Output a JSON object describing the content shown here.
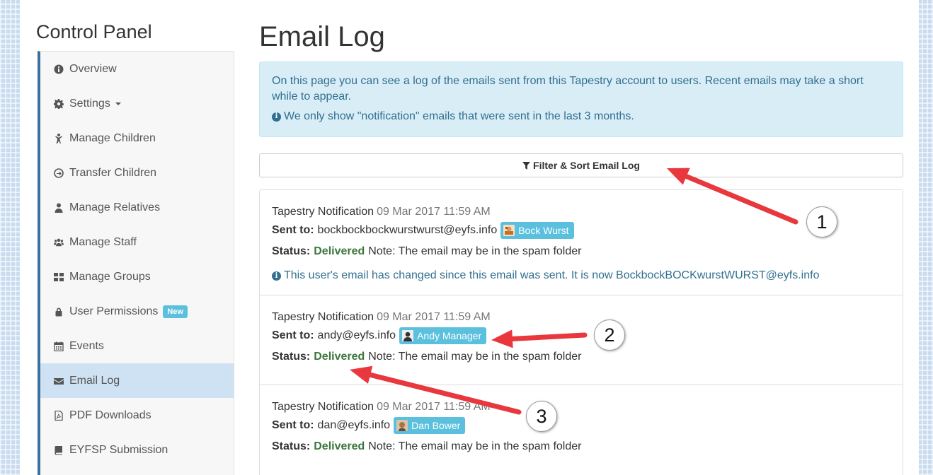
{
  "sidebar": {
    "title": "Control Panel",
    "items": [
      {
        "label": "Overview",
        "icon": "info-circle-icon"
      },
      {
        "label": "Settings",
        "icon": "gear-icon",
        "dropdown": true
      },
      {
        "label": "Manage Children",
        "icon": "child-icon"
      },
      {
        "label": "Transfer Children",
        "icon": "transfer-circle-icon"
      },
      {
        "label": "Manage Relatives",
        "icon": "user-icon"
      },
      {
        "label": "Manage Staff",
        "icon": "users-icon"
      },
      {
        "label": "Manage Groups",
        "icon": "grid-icon"
      },
      {
        "label": "User Permissions",
        "icon": "lock-icon",
        "badge": "New"
      },
      {
        "label": "Events",
        "icon": "calendar-icon"
      },
      {
        "label": "Email Log",
        "icon": "envelope-icon",
        "active": true
      },
      {
        "label": "PDF Downloads",
        "icon": "pdf-file-icon"
      },
      {
        "label": "EYFSP Submission",
        "icon": "book-icon"
      }
    ]
  },
  "main": {
    "title": "Email Log",
    "info": {
      "text": "On this page you can see a log of the emails sent from this Tapestry account to users. Recent emails may take a short while to appear.",
      "note": "We only show \"notification\" emails that were sent in the last 3 months."
    },
    "filter_label": "Filter & Sort Email Log",
    "entries": [
      {
        "type": "Tapestry Notification",
        "date": "09 Mar 2017 11:59 AM",
        "sent_to_label": "Sent to:",
        "email": "bockbockbockwurstwurst@eyfs.info",
        "user": "Bock Wurst",
        "status_label": "Status:",
        "status": "Delivered",
        "note": "Note: The email may be in the spam folder",
        "changed_note": "This user's email has changed since this email was sent. It is now BockbockBOCKwurstWURST@eyfs.info"
      },
      {
        "type": "Tapestry Notification",
        "date": "09 Mar 2017 11:59 AM",
        "sent_to_label": "Sent to:",
        "email": "andy@eyfs.info",
        "user": "Andy Manager",
        "status_label": "Status:",
        "status": "Delivered",
        "note": "Note: The email may be in the spam folder"
      },
      {
        "type": "Tapestry Notification",
        "date": "09 Mar 2017 11:59 AM",
        "sent_to_label": "Sent to:",
        "email": "dan@eyfs.info",
        "user": "Dan Bower",
        "status_label": "Status:",
        "status": "Delivered",
        "note": "Note: The email may be in the spam folder"
      }
    ]
  },
  "annotations": {
    "callouts": [
      "1",
      "2",
      "3"
    ],
    "arrow_color": "#e8383d"
  },
  "colors": {
    "accent": "#3a6f9f",
    "info_bg": "#d9edf7",
    "info_text": "#31708f",
    "badge": "#5bc0de",
    "delivered": "#3c763d"
  }
}
